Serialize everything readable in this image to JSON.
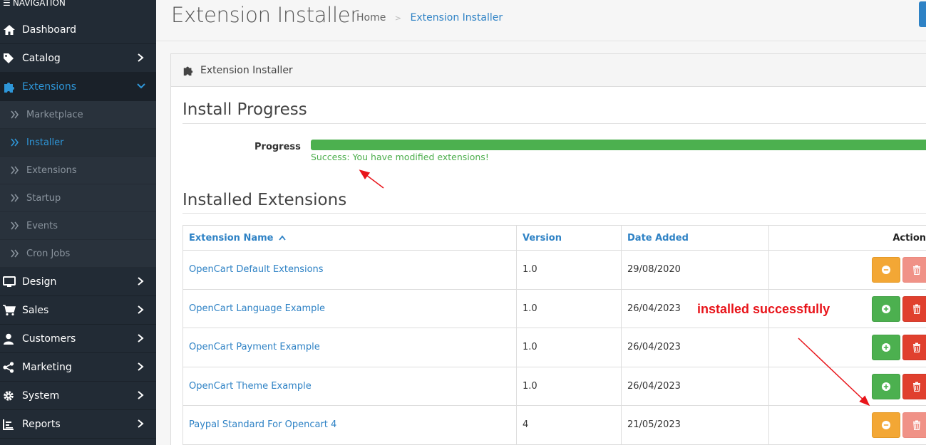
{
  "sidebar": {
    "heading": "NAVIGATION",
    "items": [
      {
        "label": "Dashboard",
        "icon": "home-icon"
      },
      {
        "label": "Catalog",
        "icon": "tag-icon"
      },
      {
        "label": "Extensions",
        "icon": "puzzle-icon"
      }
    ],
    "extensions_sub": [
      {
        "label": "Marketplace"
      },
      {
        "label": "Installer"
      },
      {
        "label": "Extensions"
      },
      {
        "label": "Startup"
      },
      {
        "label": "Events"
      },
      {
        "label": "Cron Jobs"
      }
    ],
    "items_after": [
      {
        "label": "Design",
        "icon": "desktop-icon"
      },
      {
        "label": "Sales",
        "icon": "cart-icon"
      },
      {
        "label": "Customers",
        "icon": "user-icon"
      },
      {
        "label": "Marketing",
        "icon": "share-icon"
      },
      {
        "label": "System",
        "icon": "gear-icon"
      },
      {
        "label": "Reports",
        "icon": "bar-chart-icon"
      }
    ]
  },
  "header": {
    "title": "Extension Installer",
    "breadcrumb_home": "Home",
    "breadcrumb_current": "Extension Installer"
  },
  "card": {
    "title": "Extension Installer"
  },
  "install_progress": {
    "title": "Install Progress",
    "label": "Progress",
    "percent": 100,
    "message": "Success: You have modified extensions!"
  },
  "installed": {
    "title": "Installed Extensions",
    "columns": {
      "name": "Extension Name",
      "version": "Version",
      "date": "Date Added",
      "action": "Action"
    },
    "rows": [
      {
        "name": "OpenCart Default Extensions",
        "version": "1.0",
        "date": "29/08/2020",
        "installed": true
      },
      {
        "name": "OpenCart Language Example",
        "version": "1.0",
        "date": "26/04/2023",
        "installed": false
      },
      {
        "name": "OpenCart Payment Example",
        "version": "1.0",
        "date": "26/04/2023",
        "installed": false
      },
      {
        "name": "OpenCart Theme Example",
        "version": "1.0",
        "date": "26/04/2023",
        "installed": false
      },
      {
        "name": "Paypal Standard For Opencart 4",
        "version": "4",
        "date": "21/05/2023",
        "installed": true
      }
    ]
  },
  "annotation": {
    "text": "installed successfully",
    "color": "#e8141a"
  },
  "colors": {
    "sidebar_bg": "#222b35",
    "accent": "#2e82c5",
    "success": "#4cb04f",
    "warning": "#f3a735",
    "danger": "#e0402e"
  }
}
